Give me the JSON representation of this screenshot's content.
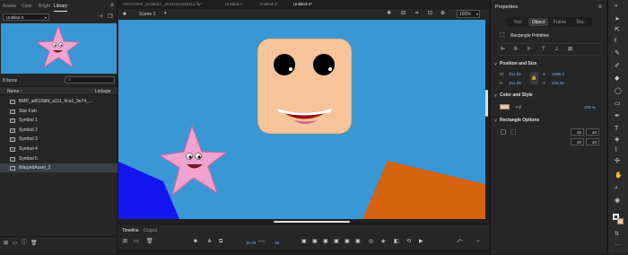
{
  "left_panel": {
    "tabs": [
      "Assets",
      "Color",
      "Bright",
      "Library"
    ],
    "doc_select": "Untitled-3",
    "count": "8 items",
    "col_name": "Name",
    "col_linkage": "Linkage",
    "items": [
      "BMP_ad610dfd_a111_4ca1_9e74_...",
      "Star Fish",
      "Symbol 1",
      "Symbol 2",
      "Symbol 3",
      "Symbol 4",
      "Symbol 5",
      "WarpedAsset_2"
    ]
  },
  "doc_tabs": [
    "RECOVER_Untitled-1_20231211153111.fla*",
    "Untitled-1",
    "Untitled-2*",
    "Untitled-3*"
  ],
  "scene": "Scene 1",
  "zoom": "100%",
  "timeline": {
    "tabs": [
      "Timeline",
      "Output"
    ],
    "fps": "30.00",
    "fps_unit": "FPS",
    "frame": "30"
  },
  "properties": {
    "title": "Properties",
    "tabs": [
      "Tool",
      "Object",
      "Frame",
      "Doc"
    ],
    "object_type": "Rectangle Primitive",
    "position_size": "Position and Size",
    "w_label": "W",
    "w": "251.05",
    "h_label": "H",
    "h": "251.05",
    "x_label": "X",
    "x": "1058.3",
    "y_label": "Y",
    "y": "206.05",
    "color_style": "Color and Style",
    "fill_label": "Fill",
    "fill_pct": "100 %",
    "fill_color": "#f7c49a",
    "rect_options": "Rectangle Options",
    "radii": [
      "40",
      "40",
      "40",
      "40"
    ]
  },
  "colors": {
    "stage": "#3997d6",
    "face": "#f7c49a",
    "starfish": "#f0a3cf",
    "blue_shape": "#1414f0",
    "orange_shape": "#d5620c"
  }
}
